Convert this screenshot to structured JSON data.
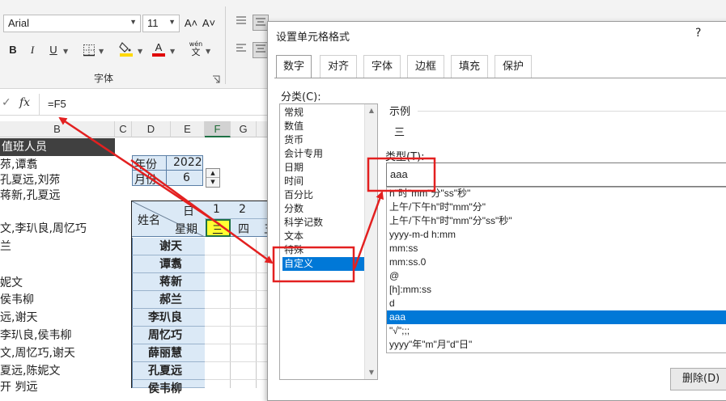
{
  "ribbon": {
    "font_name": "Arial",
    "font_size": "11",
    "grow_font_glyph": "A˄",
    "shrink_font_glyph": "A˅",
    "bold": "B",
    "italic": "I",
    "underline": "U",
    "font_color_glyph": "A",
    "phonetic_top": "wén",
    "phonetic_bottom": "文",
    "font_group_label": "字体",
    "highlight_color": "#ffd800",
    "font_color": "#e00000"
  },
  "formula_bar": {
    "fx_label": "fx",
    "formula": "=F5"
  },
  "grid": {
    "col_headers": [
      "B",
      "C",
      "D",
      "E",
      "F",
      "G"
    ],
    "selected_column": "F",
    "col_b_rows": [
      "值班人员",
      "茒,谭翥",
      "孔夏远,刘茒",
      "蒋新,孔夏远",
      "",
      "文,李玐良,周忆巧",
      "兰",
      "",
      "妮文",
      "侯韦柳",
      "远,谢天",
      "李玐良,侯韦柳",
      "文,周忆巧,谢天",
      "夏远,陈妮文",
      "开 刿远"
    ],
    "year_label": "年份",
    "year_value": "2022",
    "month_label": "月份",
    "month_value": "6",
    "name_header": "姓名",
    "day_header": "日",
    "weekday_header": "星期",
    "day_numbers": [
      "1",
      "2"
    ],
    "weekdays": [
      "三",
      "四",
      "五"
    ],
    "names": [
      "谢天",
      "谭翥",
      "蒋新",
      "郝兰",
      "李玐良",
      "周忆巧",
      "薛丽慧",
      "孔夏远",
      "侯韦柳"
    ]
  },
  "dialog": {
    "title": "设置单元格格式",
    "help": "?",
    "tabs": [
      "数字",
      "对齐",
      "字体",
      "边框",
      "填充",
      "保护"
    ],
    "active_tab": "数字",
    "category_label": "分类(C):",
    "categories": [
      "常规",
      "数值",
      "货币",
      "会计专用",
      "日期",
      "时间",
      "百分比",
      "分数",
      "科学记数",
      "文本",
      "特殊",
      "自定义"
    ],
    "selected_category": "自定义",
    "sample_label": "示例",
    "sample_value": "三",
    "type_label": "类型(T):",
    "type_value": "aaa",
    "format_list": [
      "h\"时\"mm\"分\"ss\"秒\"",
      "上午/下午h\"时\"mm\"分\"",
      "上午/下午h\"时\"mm\"分\"ss\"秒\"",
      "yyyy-m-d h:mm",
      "mm:ss",
      "mm:ss.0",
      "@",
      "[h]:mm:ss",
      "d",
      "aaa",
      "\"√\";;;",
      "yyyy\"年\"m\"月\"d\"日\""
    ],
    "selected_format": "aaa",
    "delete_button": "删除(D)"
  },
  "annotation_color": "#e32020",
  "accent_color": "#0078d7",
  "highlight_cell_color": "#ffff33"
}
